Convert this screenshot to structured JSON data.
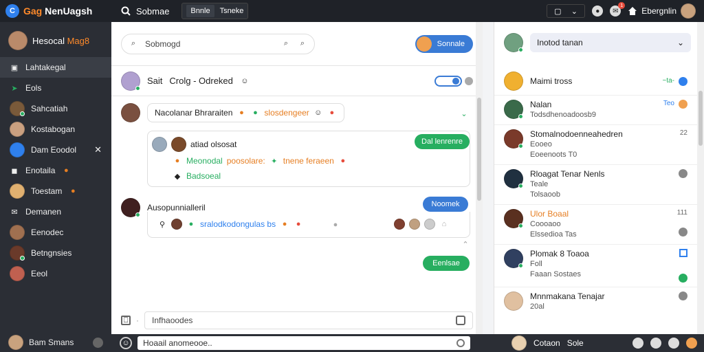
{
  "topbar": {
    "logo_accent": "Gag",
    "logo_rest": "NenUagsh",
    "search_label": "Sobmae",
    "tabs": [
      "Bnnle",
      "Tsneke"
    ],
    "user_name": "Ebergnlin"
  },
  "sidebar": {
    "profile_first": "Hesocal",
    "profile_accent": "Mag8",
    "items": [
      {
        "label": "Lahtakegal",
        "icon": "contact-icon"
      },
      {
        "label": "Eols",
        "icon": "leaf-icon"
      },
      {
        "label": "Sahcatiah",
        "icon": "avatar"
      },
      {
        "label": "Kostabogan",
        "icon": "avatar"
      },
      {
        "label": "Dam Eoodol",
        "icon": "avatar"
      },
      {
        "label": "Enotaila",
        "icon": "camera-icon"
      },
      {
        "label": "Toestam",
        "icon": "avatar"
      },
      {
        "label": "Demanen",
        "icon": "mail-icon"
      },
      {
        "label": "Eenodec",
        "icon": "avatar"
      },
      {
        "label": "Betngnsies",
        "icon": "avatar"
      },
      {
        "label": "Eeol",
        "icon": "avatar"
      }
    ],
    "footer_name": "Bam Smans"
  },
  "main": {
    "search_placeholder": "Sobmogd",
    "action_button": "Sonnale",
    "chat_title_a": "Sait",
    "chat_title_b": "Crolg - Odreked",
    "msg1": {
      "text_a": "Nacolanar Bhraraiten",
      "text_b": "slosdengeer"
    },
    "card1": {
      "title": "atiad olsosat",
      "button": "Dal lenrenre",
      "line_a": "Meonodal",
      "line_b": "poosolare:",
      "line_c": "tnene feraeen",
      "line_d": "Badsoeal"
    },
    "msg2": {
      "text": "Ausopunnialleril",
      "button": "Noomek"
    },
    "card2": {
      "text": "sralodkodongulas bs"
    },
    "send_button": "Eenlsae",
    "compose_placeholder": "Infhaoodes"
  },
  "bottombar": {
    "input_placeholder": "Hoaail anomeooe..",
    "user_label": "Cotaon",
    "user_label_b": "Sole"
  },
  "right": {
    "dropdown_value": "Inotod tanan",
    "items": [
      {
        "name": "Maimi tross",
        "sub": "",
        "sub2": "",
        "meta": "~ta-"
      },
      {
        "name": "Nalan",
        "sub": "Todsdhenoadoosb9",
        "sub2": "",
        "meta": "Teo"
      },
      {
        "name": "Stomalnodoenneahedren",
        "sub": "Eooeo",
        "sub2": "Eoeenoots T0",
        "meta": "22"
      },
      {
        "name": "Rloagat Tenar Nenls",
        "sub": "Teale",
        "sub2": "Tolsaoob",
        "meta": ""
      },
      {
        "name": "Ulor Boaal",
        "sub": "Coooaoo",
        "sub2": "Elssedioa Tas",
        "meta": "111"
      },
      {
        "name": "Plomak 8 Toaoa",
        "sub": "Foll",
        "sub2": "Faaan Sostaes",
        "meta": ""
      },
      {
        "name": "Mnnmakana Tenajar",
        "sub": "20al",
        "sub2": "",
        "meta": ""
      }
    ]
  },
  "colors": {
    "sidebar_bg": "#2b2e35",
    "accent_blue": "#3a7bd5",
    "accent_green": "#27ae60",
    "accent_orange": "#ff8a2a"
  }
}
